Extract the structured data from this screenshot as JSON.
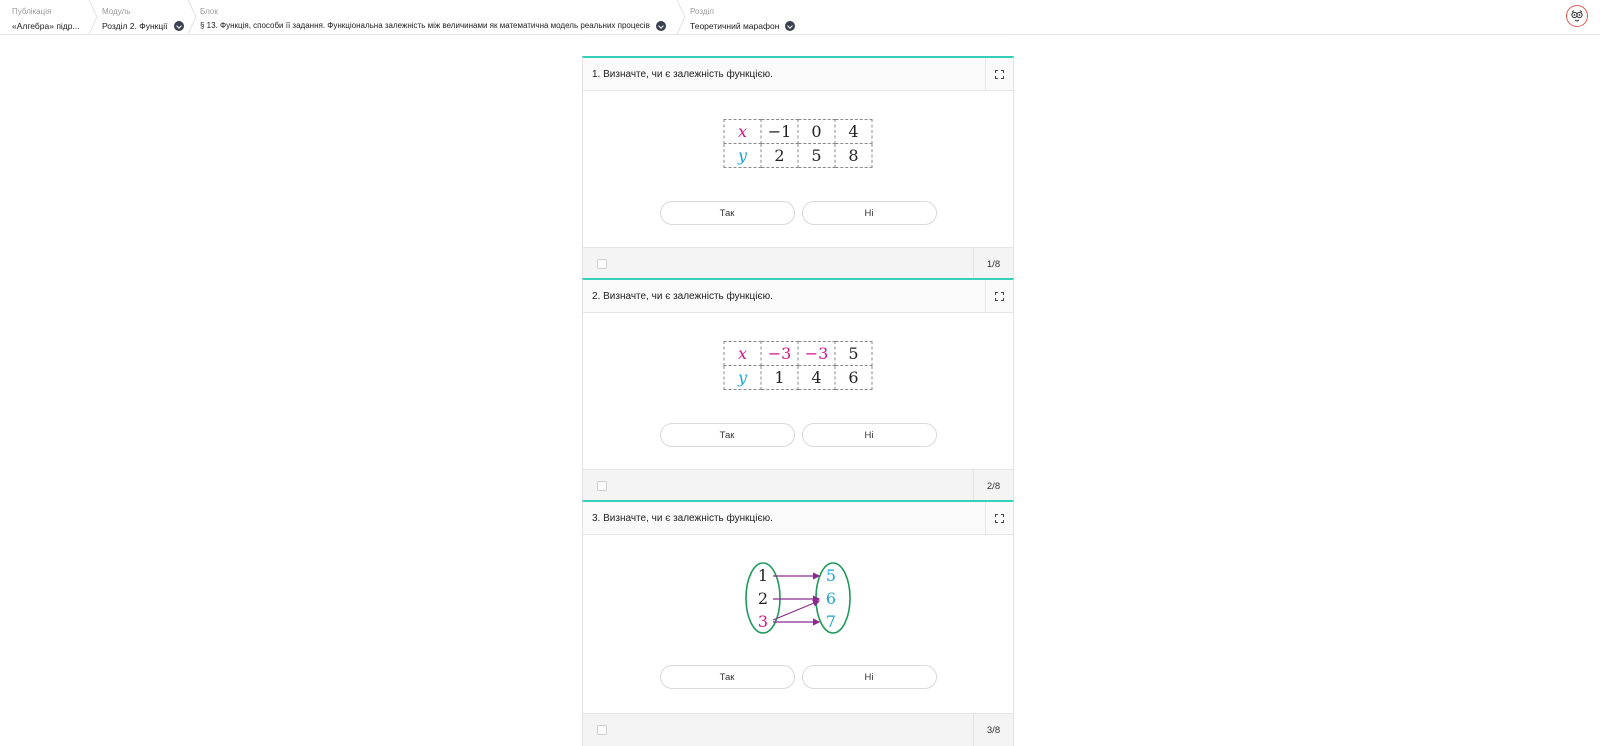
{
  "breadcrumbs": [
    {
      "label": "Публікація",
      "value": "«Алгебра» підр..."
    },
    {
      "label": "Модуль",
      "value": "Розділ 2. Функції"
    },
    {
      "label": "Блок",
      "value": "§ 13. Функція, способи її задання. Функціональна залежність між величинами як математична модель реальних процесів"
    },
    {
      "label": "Розділ",
      "value": "Теоретичний марафон"
    }
  ],
  "icons": {
    "dropdown": "chevron-down-icon",
    "expand": "expand-icon",
    "avatar": "owl-avatar-icon"
  },
  "colors": {
    "accent": "#35d0ba",
    "x_color": "#d4148c",
    "y_color": "#1ea5d6",
    "oval_color": "#1e9a5a",
    "arrow_color": "#8b2a8e"
  },
  "questions": [
    {
      "title": "1. Визначте, чи є залежність функцією.",
      "table": {
        "x_label": "x",
        "y_label": "y",
        "x": [
          "−1",
          "0",
          "4"
        ],
        "y": [
          "2",
          "5",
          "8"
        ]
      },
      "answers": [
        "Так",
        "Ні"
      ],
      "page": "1/8"
    },
    {
      "title": "2. Визначте, чи є залежність функцією.",
      "table": {
        "x_label": "x",
        "y_label": "y",
        "x": [
          "−3",
          "−3",
          "5"
        ],
        "y": [
          "1",
          "4",
          "6"
        ]
      },
      "answers": [
        "Так",
        "Ні"
      ],
      "page": "2/8"
    },
    {
      "title": "3. Визначте, чи є залежність функцією.",
      "mapping": {
        "left": [
          "1",
          "2",
          "3"
        ],
        "right": [
          "5",
          "6",
          "7"
        ]
      },
      "answers": [
        "Так",
        "Ні"
      ],
      "page": "3/8"
    }
  ]
}
